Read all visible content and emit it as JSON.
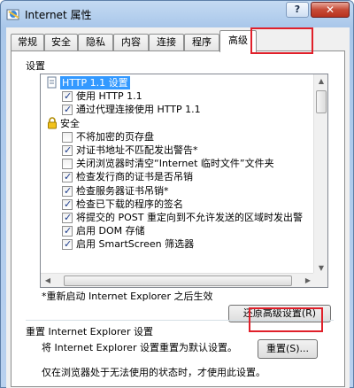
{
  "window": {
    "title": "Internet 属性",
    "help_label": "?",
    "close_label": "✕"
  },
  "tabs": [
    {
      "label": "常规"
    },
    {
      "label": "安全"
    },
    {
      "label": "隐私"
    },
    {
      "label": "内容"
    },
    {
      "label": "连接"
    },
    {
      "label": "程序"
    },
    {
      "label": "高级"
    }
  ],
  "active_tab": "高级",
  "settings": {
    "group_label": "设置",
    "items": [
      {
        "text": "HTTP 1.1 设置",
        "type": "category",
        "selected": true
      },
      {
        "text": "使用 HTTP 1.1",
        "type": "checkbox",
        "checked": true
      },
      {
        "text": "通过代理连接使用 HTTP 1.1",
        "type": "checkbox",
        "checked": true
      },
      {
        "text": "安全",
        "type": "category-lock"
      },
      {
        "text": "不将加密的页存盘",
        "type": "checkbox",
        "checked": false
      },
      {
        "text": "对证书地址不匹配发出警告*",
        "type": "checkbox",
        "checked": true
      },
      {
        "text": "关闭浏览器时清空“Internet 临时文件”文件夹",
        "type": "checkbox",
        "checked": false
      },
      {
        "text": "检查发行商的证书是否吊销",
        "type": "checkbox",
        "checked": true
      },
      {
        "text": "检查服务器证书吊销*",
        "type": "checkbox",
        "checked": true
      },
      {
        "text": "检查已下载的程序的签名",
        "type": "checkbox",
        "checked": true
      },
      {
        "text": "将提交的 POST 重定向到不允许发送的区域时发出警",
        "type": "checkbox",
        "checked": true
      },
      {
        "text": "启用 DOM 存储",
        "type": "checkbox",
        "checked": true
      },
      {
        "text": "启用 SmartScreen 筛选器",
        "type": "checkbox",
        "checked": true
      }
    ],
    "restart_note": "*重新启动 Internet Explorer 之后生效",
    "restore_button": "还原高级设置(R)"
  },
  "reset": {
    "title": "重置 Internet Explorer 设置",
    "description": "将 Internet Explorer 设置重置为默认设置。",
    "button": "重置(S)...",
    "footer": "仅在浏览器处于无法使用的状态时，才使用此设置。"
  },
  "colors": {
    "highlight": "#e0202a",
    "selection": "#3399ff"
  }
}
